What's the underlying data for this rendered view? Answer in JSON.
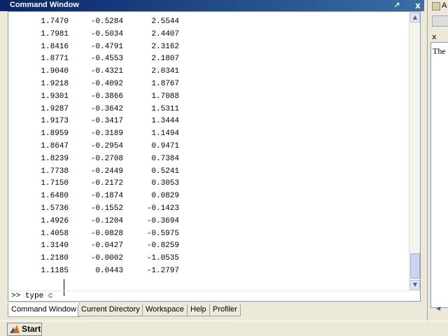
{
  "window": {
    "title": "Command Window"
  },
  "output_rows": [
    [
      "1.7470",
      "-0.5284",
      "2.5544"
    ],
    [
      "1.7981",
      "-0.5034",
      "2.4407"
    ],
    [
      "1.8416",
      "-0.4791",
      "2.3162"
    ],
    [
      "1.8771",
      "-0.4553",
      "2.1807"
    ],
    [
      "1.9040",
      "-0.4321",
      "2.0341"
    ],
    [
      "1.9218",
      "-0.4092",
      "1.8767"
    ],
    [
      "1.9301",
      "-0.3866",
      "1.7088"
    ],
    [
      "1.9287",
      "-0.3642",
      "1.5311"
    ],
    [
      "1.9173",
      "-0.3417",
      "1.3444"
    ],
    [
      "1.8959",
      "-0.3189",
      "1.1494"
    ],
    [
      "1.8647",
      "-0.2954",
      "0.9471"
    ],
    [
      "1.8239",
      "-0.2708",
      "0.7384"
    ],
    [
      "1.7738",
      "-0.2449",
      "0.5241"
    ],
    [
      "1.7150",
      "-0.2172",
      "0.3053"
    ],
    [
      "1.6480",
      "-0.1874",
      "0.0829"
    ],
    [
      "1.5736",
      "-0.1552",
      "-0.1423"
    ],
    [
      "1.4926",
      "-0.1204",
      "-0.3694"
    ],
    [
      "1.4058",
      "-0.0828",
      "-0.5975"
    ],
    [
      "1.3140",
      "-0.0427",
      "-0.8259"
    ],
    [
      "1.2180",
      "-0.0002",
      "-1.0535"
    ],
    [
      "1.1185",
      "0.0443",
      "-1.2797"
    ]
  ],
  "prompt": {
    "symbol": ">>",
    "command": "type",
    "typed_arg": "c"
  },
  "tabs": [
    {
      "label": "Command Window",
      "active": true
    },
    {
      "label": "Current Directory",
      "active": false
    },
    {
      "label": "Workspace",
      "active": false
    },
    {
      "label": "Help",
      "active": false
    },
    {
      "label": "Profiler",
      "active": false
    }
  ],
  "right_panel": {
    "top_label": "A",
    "text": "The",
    "close": "x"
  },
  "titlebar_buttons": {
    "undock": "↗",
    "close": "x"
  },
  "taskbar": {
    "start_label": "Start"
  },
  "colors": {
    "title_bar": "#0a246a",
    "typed_arg": "#c000c0",
    "taskbar": "#ece9d8"
  }
}
